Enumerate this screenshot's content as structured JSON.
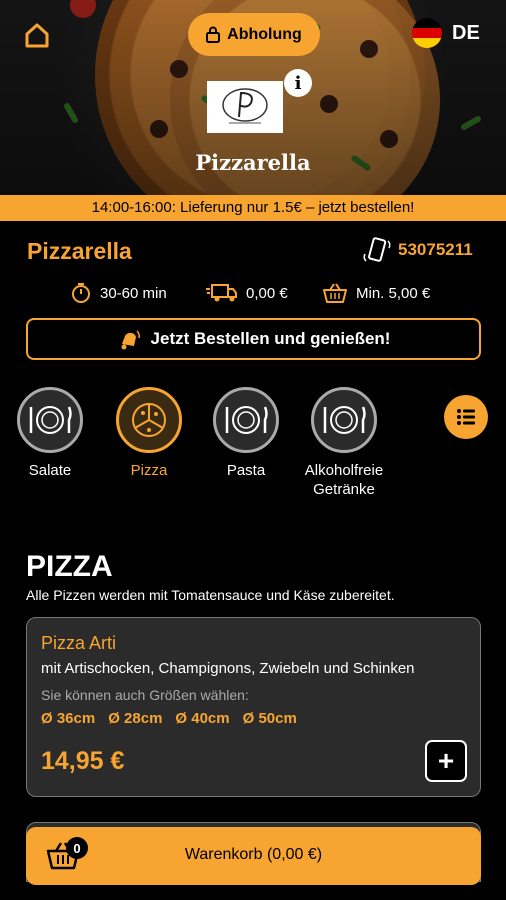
{
  "header": {
    "pickup_label": "Abholung",
    "language": "DE",
    "brand_name": "Pizzarella",
    "info_symbol": "i"
  },
  "promo_banner": "14:00-16:00: Lieferung nur 1.5€ – jetzt bestellen!",
  "restaurant": {
    "name": "Pizzarella",
    "phone": "53075211",
    "delivery_time": "30-60 min",
    "delivery_fee": "0,00 €",
    "min_order": "Min. 5,00 €",
    "cta": "Jetzt Bestellen und genießen!"
  },
  "categories": [
    {
      "label": "Salate",
      "icon": "plate-cutlery-icon"
    },
    {
      "label": "Pizza",
      "icon": "pizza-slice-icon"
    },
    {
      "label": "Pasta",
      "icon": "plate-cutlery-icon"
    },
    {
      "label": "Alkoholfreie Getränke",
      "icon": "plate-cutlery-icon"
    }
  ],
  "section": {
    "title": "PIZZA",
    "description": "Alle Pizzen werden mit Tomatensauce und Käse zubereitet."
  },
  "product": {
    "name": "Pizza Arti",
    "description": "mit Artischocken, Champignons, Zwiebeln und Schinken",
    "sizes_hint": "Sie können auch Größen wählen:",
    "sizes": [
      "Ø 36cm",
      "Ø 28cm",
      "Ø 40cm",
      "Ø 50cm"
    ],
    "price": "14,95 €",
    "add_symbol": "+"
  },
  "cart": {
    "count": "0",
    "label": "Warenkorb (0,00 €)"
  },
  "colors": {
    "accent": "#f7a530",
    "background": "#000000",
    "card": "#2b2b2b"
  }
}
